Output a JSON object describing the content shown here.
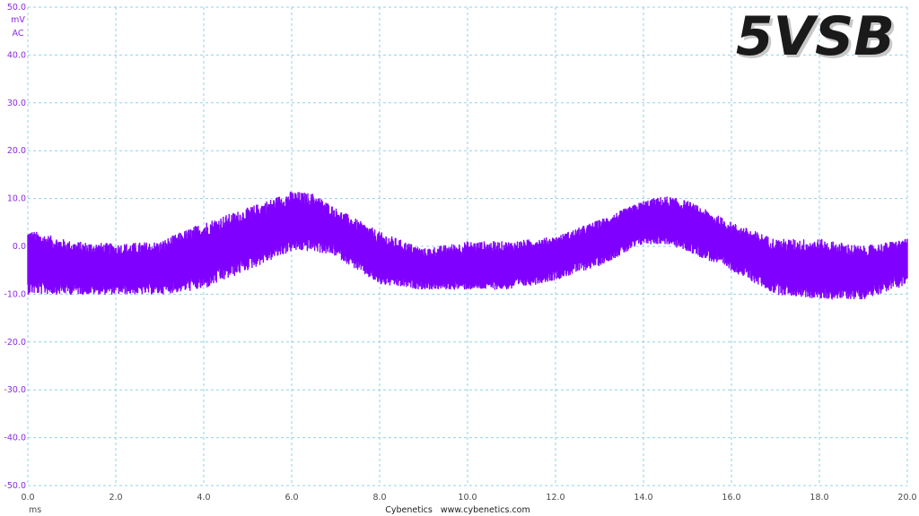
{
  "badge": "5VSB",
  "credit": "Cybenetics   www.cybenetics.com",
  "colors": {
    "trace": "#8000ff",
    "grid": "#8fd3e8",
    "yaxis_text": "#8a2be2",
    "xaxis_text": "#4b4b4b"
  },
  "chart_data": {
    "type": "line",
    "title": "",
    "xlabel": "ms",
    "ylabel": "mV",
    "ylabel_coupling": "AC",
    "xlim": [
      0,
      20
    ],
    "ylim": [
      -50,
      50
    ],
    "x_ticks": [
      "0.0",
      "2.0",
      "4.0",
      "6.0",
      "8.0",
      "10.0",
      "12.0",
      "14.0",
      "16.0",
      "18.0",
      "20.0"
    ],
    "y_ticks": [
      "50.0",
      "40.0",
      "30.0",
      "20.0",
      "10.0",
      "0.0",
      "-10.0",
      "-20.0",
      "-30.0",
      "-40.0",
      "-50.0"
    ],
    "grid": true,
    "series": [
      {
        "color": "#8000ff",
        "x": [
          0,
          1,
          2,
          3,
          4,
          5,
          6,
          6.5,
          7,
          8,
          9,
          10,
          11,
          12,
          13,
          14,
          14.5,
          15,
          16,
          17,
          18,
          19,
          20
        ],
        "center": [
          -3.5,
          -4.5,
          -5.5,
          -5,
          -2,
          2,
          5,
          5,
          3,
          -3,
          -5,
          -5,
          -4,
          -2,
          1,
          5,
          5,
          4,
          0,
          -4,
          -5.5,
          -5.5,
          -2
        ],
        "max": [
          3.5,
          1,
          0.5,
          1,
          5,
          8,
          11.5,
          11,
          8,
          3,
          -0.5,
          1,
          1,
          2,
          5.5,
          9.5,
          10.5,
          9.5,
          5,
          1.5,
          1.5,
          0,
          1.5
        ],
        "min": [
          -10,
          -10,
          -10,
          -10,
          -9,
          -5,
          -1,
          -1,
          -2,
          -8,
          -9,
          -9,
          -9,
          -7,
          -4,
          0.5,
          0.5,
          -1,
          -5,
          -10,
          -11,
          -11,
          -8
        ]
      }
    ]
  }
}
